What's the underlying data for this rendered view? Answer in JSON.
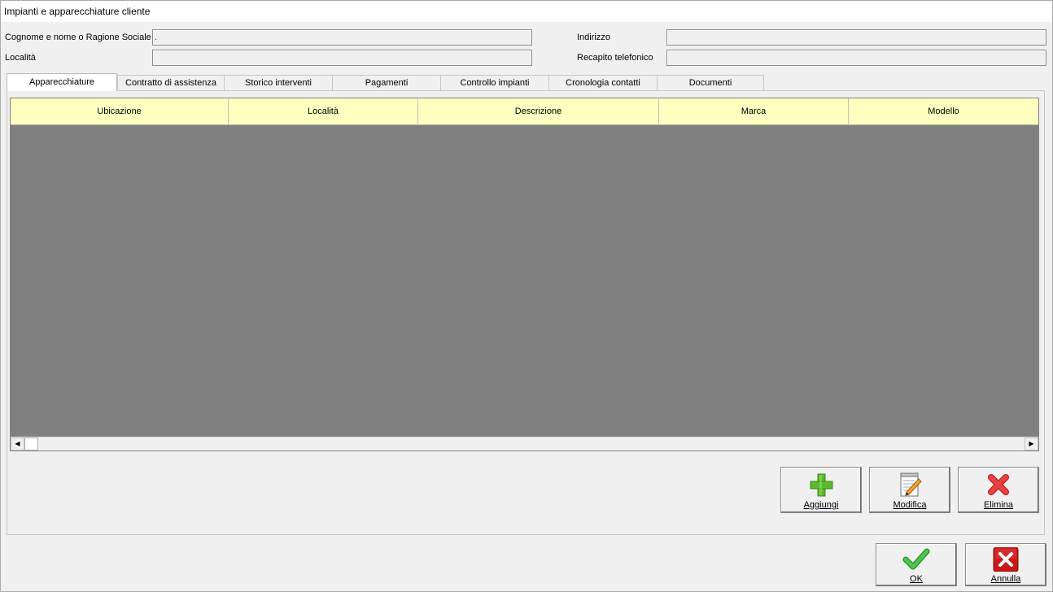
{
  "window": {
    "title": "Impianti e apparecchiature cliente"
  },
  "client": {
    "name_label": "Cognome e nome o Ragione Sociale",
    "name_value": ".",
    "locality_label": "Località",
    "locality_value": "",
    "address_label": "Indirizzo",
    "address_value": "",
    "phone_label": "Recapito telefonico",
    "phone_value": ""
  },
  "tabs": [
    {
      "label": "Apparecchiature",
      "active": true
    },
    {
      "label": "Contratto di assistenza"
    },
    {
      "label": "Storico interventi"
    },
    {
      "label": "Pagamenti"
    },
    {
      "label": "Controllo impianti"
    },
    {
      "label": "Cronologia contatti"
    },
    {
      "label": "Documenti"
    }
  ],
  "grid": {
    "columns": [
      "Ubicazione",
      "Località",
      "Descrizione",
      "Marca",
      "Modello"
    ],
    "rows": []
  },
  "actions": {
    "add_label": "Aggiungi",
    "edit_label": "Modifica",
    "delete_label": "Elimina"
  },
  "dialog": {
    "ok_label": "OK",
    "cancel_label": "Annulla"
  },
  "colors": {
    "grid_header": "#ffffc0",
    "grid_body": "#808080",
    "add_green": "#5cb82e",
    "delete_red": "#e03030",
    "ok_green": "#3cb43c",
    "cancel_red": "#c81818"
  },
  "icons": {
    "add": "plus-icon",
    "edit": "notepad-pencil-icon",
    "delete": "red-x-icon",
    "ok": "green-check-icon",
    "cancel": "red-x-square-icon"
  }
}
